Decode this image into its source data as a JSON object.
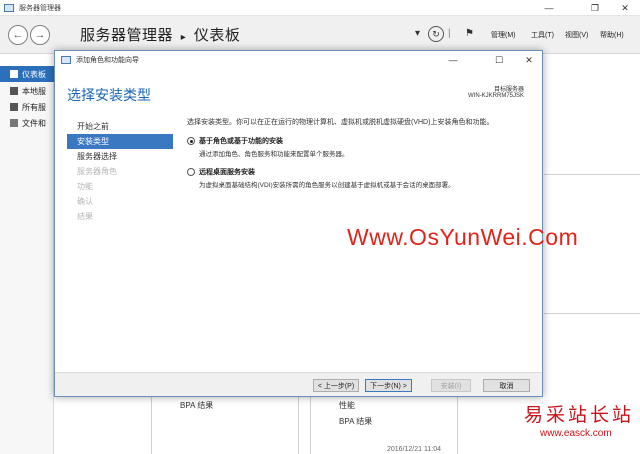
{
  "server_manager": {
    "window_title": "服务器管理器",
    "breadcrumb_app": "服务器管理器",
    "breadcrumb_sep": "▸",
    "breadcrumb_page": "仪表板",
    "menu": [
      "管理(M)",
      "工具(T)",
      "视图(V)",
      "帮助(H)"
    ],
    "sidebar": [
      {
        "label": "仪表板"
      },
      {
        "label": "本地服"
      },
      {
        "label": "所有服"
      },
      {
        "label": "文件和"
      }
    ],
    "tiles": {
      "left_item": "BPA 结果",
      "right_item1": "性能",
      "right_item2": "BPA 结果",
      "timestamp": "2016/12/21 11:04"
    }
  },
  "wizard": {
    "window_title": "添加角色和功能向导",
    "heading": "选择安装类型",
    "target_label": "目标服务器",
    "target_server": "WIN-KJKRRM75JSK",
    "nav": [
      {
        "label": "开始之前",
        "state": "normal"
      },
      {
        "label": "安装类型",
        "state": "active"
      },
      {
        "label": "服务器选择",
        "state": "normal"
      },
      {
        "label": "服务器角色",
        "state": "disabled"
      },
      {
        "label": "功能",
        "state": "disabled"
      },
      {
        "label": "确认",
        "state": "disabled"
      },
      {
        "label": "结果",
        "state": "disabled"
      }
    ],
    "description": "选择安装类型。你可以在正在运行的物理计算机、虚拟机或脱机虚拟硬盘(VHD)上安装角色和功能。",
    "options": [
      {
        "label": "基于角色或基于功能的安装",
        "sub": "通过添加角色、角色服务和功能来配置单个服务器。",
        "selected": true
      },
      {
        "label": "远程桌面服务安装",
        "sub": "为虚拟桌面基础结构(VDI)安装所需的角色服务以创建基于虚拟机或基于会话的桌面部署。",
        "selected": false
      }
    ],
    "buttons": {
      "prev": "< 上一步(P)",
      "next": "下一步(N) >",
      "install": "安装(I)",
      "cancel": "取消"
    }
  },
  "watermarks": {
    "main": "Www.OsYunWei.Com",
    "site_cn": "易采站长站",
    "site_url": "www.easck.com"
  },
  "colors": {
    "accent": "#2c6fbb",
    "heading": "#1a66b8",
    "watermark": "#e0241c"
  }
}
